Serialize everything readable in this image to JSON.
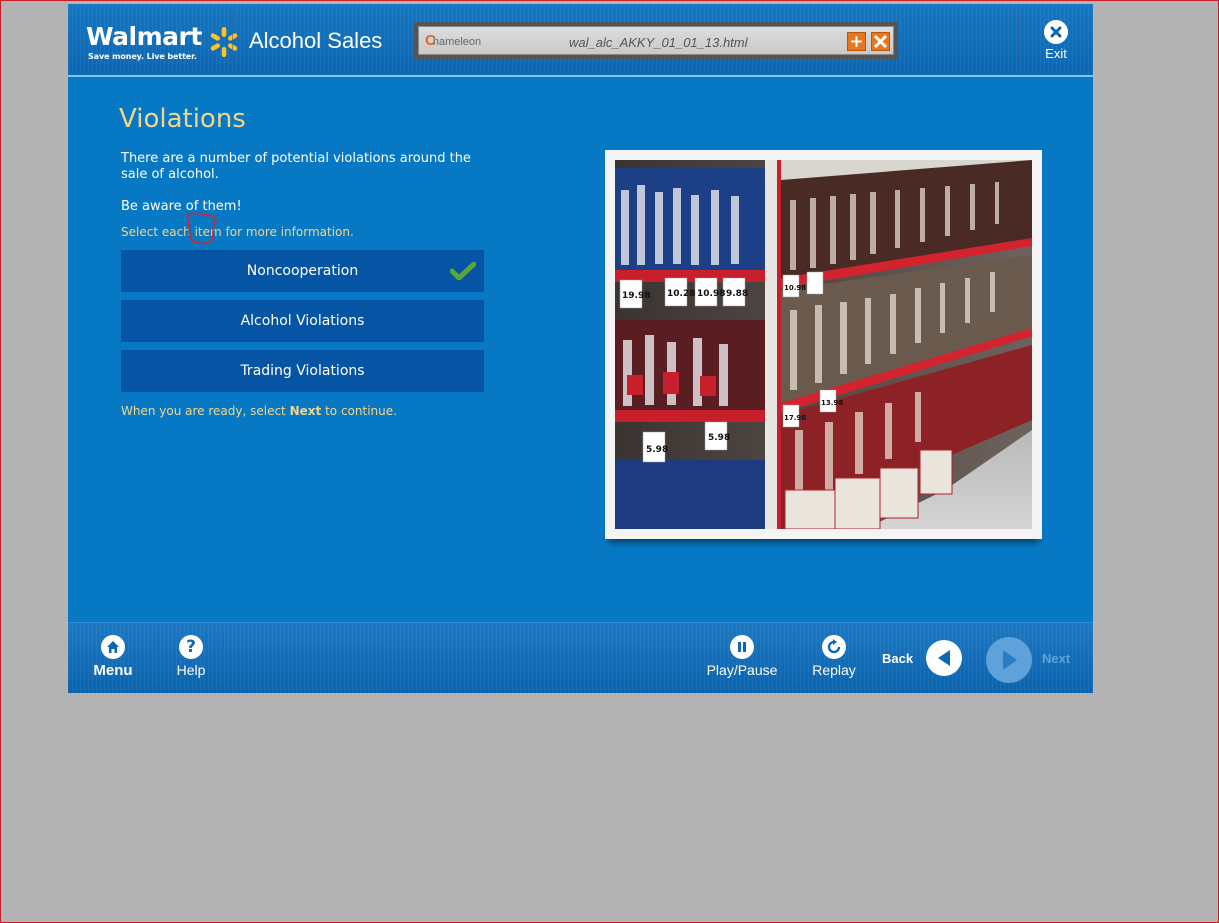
{
  "header": {
    "brand": "Walmart",
    "tagline": "Save money. Live better.",
    "course_title": "Alcohol Sales",
    "player_logo": "hameleon",
    "player_logo_initial": "C",
    "file_name": "wal_alc_AKKY_01_01_13.html",
    "exit_label": "Exit"
  },
  "content": {
    "heading": "Violations",
    "intro": "There are a number of potential violations around the sale of alcohol.",
    "aware": "Be aware of them!",
    "instruction": "Select each item for more information.",
    "options": [
      {
        "label": "Noncooperation",
        "completed": true
      },
      {
        "label": "Alcohol Violations",
        "completed": false
      },
      {
        "label": "Trading Violations",
        "completed": false
      }
    ],
    "continue_prefix": "When you are ready, select ",
    "continue_keyword": "Next",
    "continue_suffix": " to continue.",
    "price_tags": [
      "19.98",
      "10.28",
      "10.98",
      "9.88",
      "10.98",
      "5.98",
      "5.98",
      "17.98",
      "13.98"
    ]
  },
  "footer": {
    "menu_label": "Menu",
    "help_label": "Help",
    "play_pause_label": "Play/Pause",
    "replay_label": "Replay",
    "back_label": "Back",
    "next_label": "Next"
  },
  "colors": {
    "background": "#0778c4",
    "accent": "#f2d58c",
    "option_bg": "#0555a4",
    "check": "#5aa63a",
    "spark": "#ffc220"
  }
}
